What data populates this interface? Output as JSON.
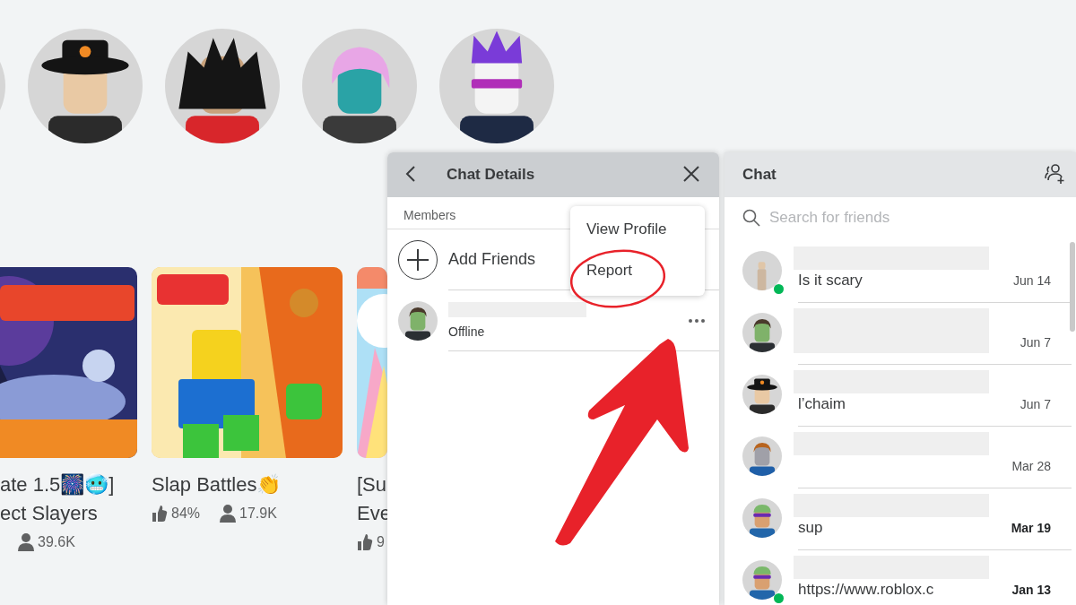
{
  "friends": [
    {
      "kind": "plain"
    },
    {
      "kind": "hat"
    },
    {
      "kind": "spiky"
    },
    {
      "kind": "hair"
    },
    {
      "kind": "crown"
    }
  ],
  "games": [
    {
      "kind": "picture",
      "cut": true,
      "title_lines": [
        "ate 1.5🎆🥶]",
        "ect Slayers"
      ],
      "players": "39.6K"
    },
    {
      "kind": "picture",
      "cut": false,
      "title_lines": [
        "Slap Battles👏"
      ],
      "rating": "84%",
      "players": "17.9K"
    },
    {
      "kind": "picture",
      "cut": false,
      "title_lines": [
        "[Su",
        "Eve"
      ],
      "rating": "9"
    }
  ],
  "chat_details": {
    "title": "Chat Details",
    "members_label": "Members",
    "add_friends": "Add Friends",
    "members": [
      {
        "kind": "green",
        "status": "Offline"
      }
    ],
    "menu": [
      "View Profile",
      "Report"
    ]
  },
  "chat": {
    "title": "Chat",
    "search": {
      "placeholder": "Search for friends"
    },
    "conversations": [
      {
        "kind": "figure",
        "preview": "Is it scary",
        "date": "Jun 14",
        "online": true,
        "unread": false,
        "preview_hidden": false
      },
      {
        "kind": "green",
        "date": "Jun 7",
        "online": false,
        "unread": false,
        "preview_hidden": true
      },
      {
        "kind": "hat",
        "preview": "l’chaim",
        "date": "Jun 7",
        "online": false,
        "unread": false,
        "preview_hidden": false
      },
      {
        "kind": "curls",
        "date": "Mar 28",
        "online": false,
        "unread": false,
        "preview_hidden": false
      },
      {
        "kind": "goggles",
        "preview": "sup",
        "date": "Mar 19",
        "online": false,
        "unread": true,
        "preview_hidden": false
      },
      {
        "kind": "goggles",
        "preview": "https://www.roblox.c",
        "date": "Jan 13",
        "online": true,
        "unread": true,
        "preview_hidden": false
      }
    ]
  },
  "annotations": {
    "circle": true,
    "arrow": true
  }
}
